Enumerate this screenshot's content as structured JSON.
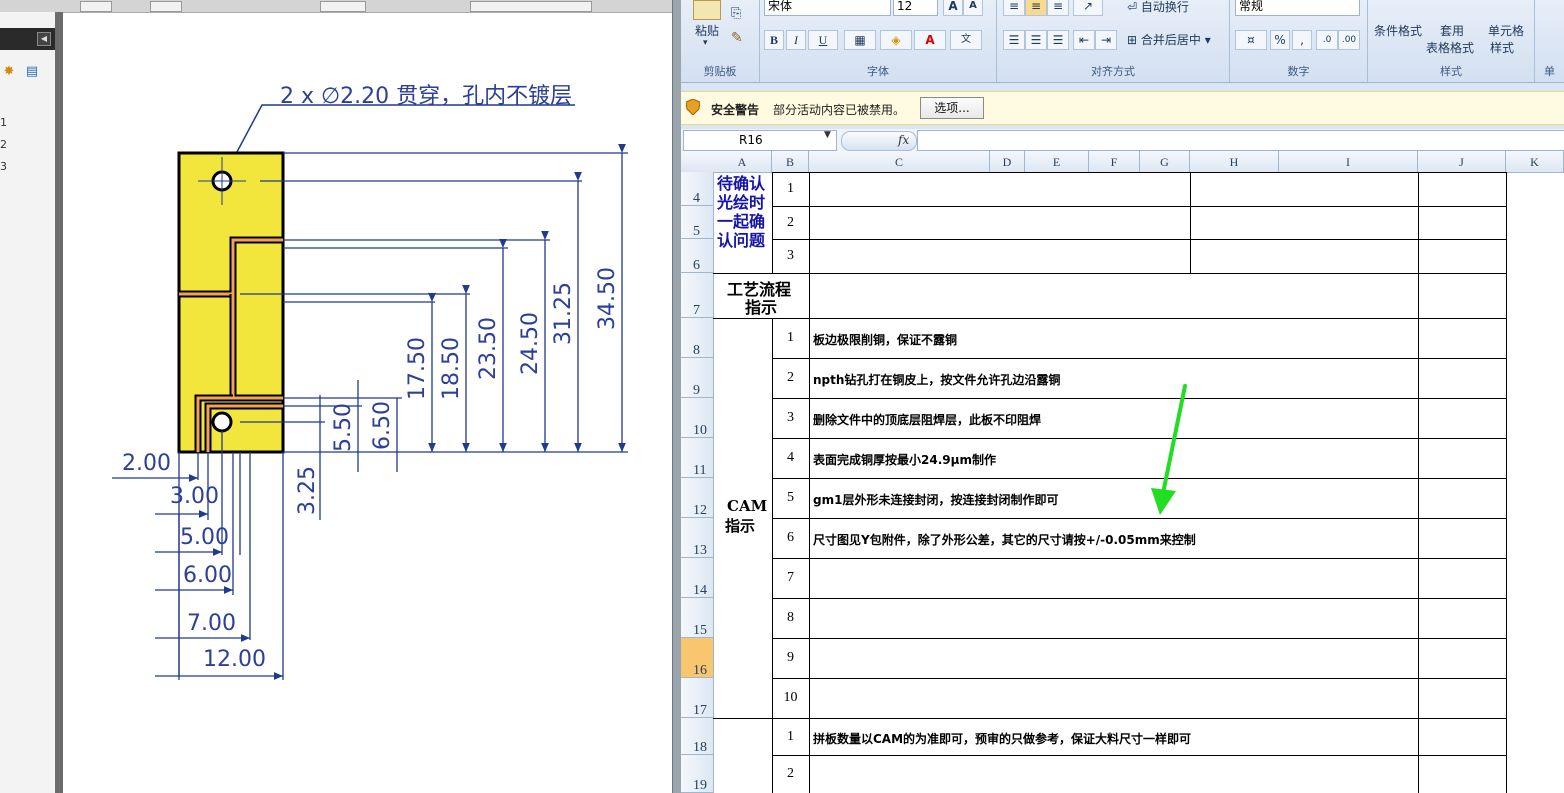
{
  "pdf": {
    "page_numbers": [
      "1",
      "2",
      "3"
    ],
    "note": "2 x ∅2.20 贯穿，孔内不镀层",
    "dims_vertical": [
      "34.50",
      "31.25",
      "24.50",
      "23.50",
      "18.50",
      "17.50",
      "6.50",
      "5.50",
      "3.25"
    ],
    "dims_horizontal": [
      "2.00",
      "3.00",
      "5.00",
      "6.00",
      "7.00",
      "12.00"
    ]
  },
  "excel": {
    "ribbon": {
      "paste": "粘贴",
      "font_name": "宋体",
      "font_size": "12",
      "bold": "B",
      "italic": "I",
      "underline": "U",
      "wrap_text": "自动换行",
      "merge_center": "合并后居中",
      "number_format": "常规",
      "percent": "%",
      "comma": ",",
      "cond_format": "条件格式",
      "table_format_1": "套用",
      "table_format_2": "表格格式",
      "cell_style_1": "单元格",
      "cell_style_2": "样式",
      "groups": [
        "剪贴板",
        "字体",
        "对齐方式",
        "数字",
        "样式",
        "单"
      ]
    },
    "security": {
      "title": "安全警告",
      "message": "部分活动内容已被禁用。",
      "options": "选项..."
    },
    "name_box": "R16",
    "fx": "fx",
    "columns": [
      "A",
      "B",
      "C",
      "D",
      "E",
      "F",
      "G",
      "H",
      "I",
      "J",
      "K"
    ],
    "rows": [
      "4",
      "5",
      "6",
      "7",
      "8",
      "9",
      "10",
      "11",
      "12",
      "13",
      "14",
      "15",
      "16",
      "17",
      "18",
      "19"
    ],
    "selected_row": "16",
    "confirm_label": [
      "待确认",
      "光绘时",
      "一起确",
      "认问题"
    ],
    "confirm_nums": [
      "1",
      "2",
      "3"
    ],
    "process_label": [
      "工艺流程",
      "指示"
    ],
    "cam_label": [
      "CAM",
      "指示"
    ],
    "cam_items": [
      {
        "n": "1",
        "text": "板边极限削铜，保证不露铜"
      },
      {
        "n": "2",
        "text": "npth钻孔打在铜皮上，按文件允许孔边沿露铜"
      },
      {
        "n": "3",
        "text": "删除文件中的顶底层阻焊层，此板不印阻焊"
      },
      {
        "n": "4",
        "text": "表面完成铜厚按最小24.9μm制作"
      },
      {
        "n": "5",
        "text": "gm1层外形未连接封闭，按连接封闭制作即可"
      },
      {
        "n": "6",
        "text": "尺寸图见Y包附件，除了外形公差，其它的尺寸请按+/-0.05mm来控制"
      },
      {
        "n": "7",
        "text": ""
      },
      {
        "n": "8",
        "text": ""
      },
      {
        "n": "9",
        "text": ""
      },
      {
        "n": "10",
        "text": ""
      }
    ],
    "panel_items": [
      {
        "n": "1",
        "text": "拼板数量以CAM的为准即可，预审的只做参考，保证大料尺寸一样即可"
      },
      {
        "n": "2",
        "text": ""
      }
    ],
    "arrow_color": "#22dd22"
  }
}
